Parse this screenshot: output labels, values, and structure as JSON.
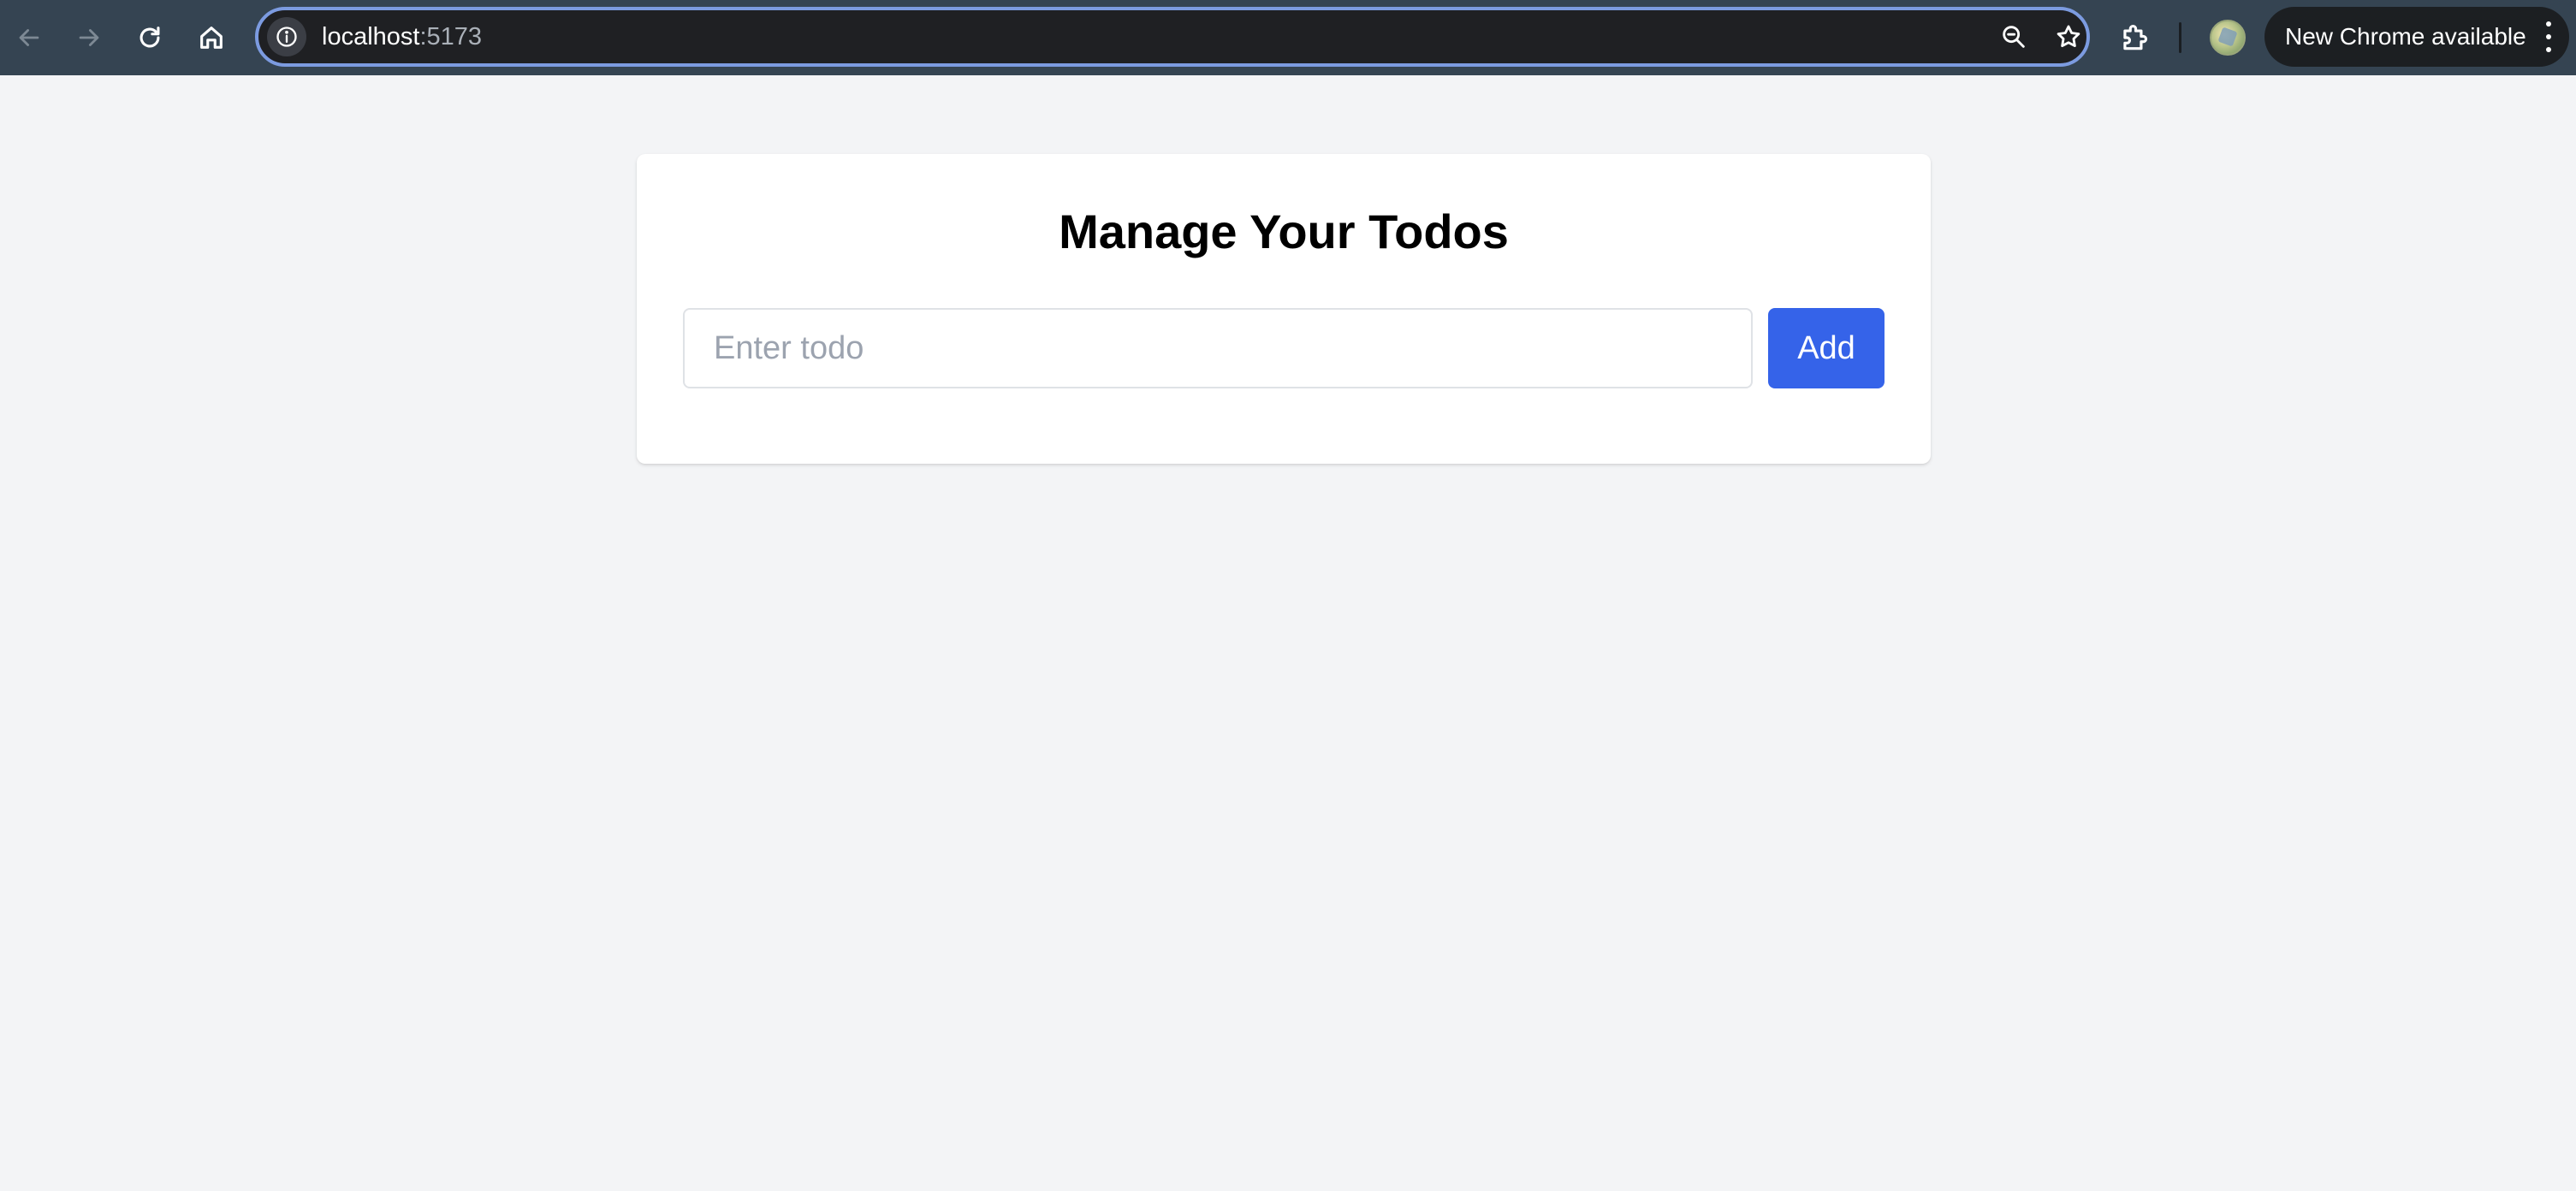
{
  "browser": {
    "url_host": "localhost",
    "url_port": ":5173",
    "update_label": "New Chrome available"
  },
  "app": {
    "title": "Manage Your Todos",
    "input": {
      "value": "",
      "placeholder": "Enter todo"
    },
    "add_label": "Add"
  },
  "colors": {
    "toolbar_bg": "#354452",
    "page_bg": "#f3f4f6",
    "button_accent": "#3563e9",
    "omnibox_focus": "#7c9be0"
  }
}
